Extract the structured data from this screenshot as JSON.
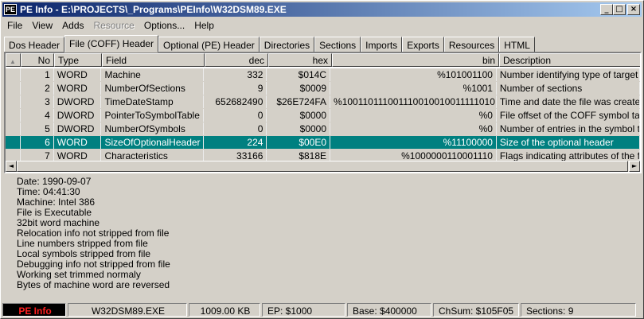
{
  "window": {
    "title": "PE Info - E:\\PROJECTS\\_Programs\\PEInfo\\W32DSM89.EXE",
    "icon_text": "PE",
    "minimize": "_",
    "maximize": "□",
    "close": "×"
  },
  "menu": [
    {
      "label": "File"
    },
    {
      "label": "View"
    },
    {
      "label": "Adds"
    },
    {
      "label": "Resource",
      "disabled": true
    },
    {
      "label": "Options..."
    },
    {
      "label": "Help"
    }
  ],
  "tabs": [
    {
      "label": "Dos Header"
    },
    {
      "label": "File (COFF) Header",
      "active": true
    },
    {
      "label": "Optional (PE) Header"
    },
    {
      "label": "Directories"
    },
    {
      "label": "Sections"
    },
    {
      "label": "Imports"
    },
    {
      "label": "Exports"
    },
    {
      "label": "Resources"
    },
    {
      "label": "HTML"
    }
  ],
  "table": {
    "sort_indicator": "▲",
    "columns": [
      "No",
      "Type",
      "Field",
      "dec",
      "hex",
      "bin",
      "Description"
    ],
    "rows": [
      {
        "no": "1",
        "type": "WORD",
        "field": "Machine",
        "dec": "332",
        "hex": "$014C",
        "bin": "%101001100",
        "desc": "Number identifying type of target mac"
      },
      {
        "no": "2",
        "type": "WORD",
        "field": "NumberOfSections",
        "dec": "9",
        "hex": "$0009",
        "bin": "%1001",
        "desc": "Number of sections"
      },
      {
        "no": "3",
        "type": "DWORD",
        "field": "TimeDateStamp",
        "dec": "652682490",
        "hex": "$26E724FA",
        "bin": "%100110111001110010010011111010",
        "desc": "Time and date the file was created"
      },
      {
        "no": "4",
        "type": "DWORD",
        "field": "PointerToSymbolTable",
        "dec": "0",
        "hex": "$0000",
        "bin": "%0",
        "desc": "File offset of the COFF symbol table o"
      },
      {
        "no": "5",
        "type": "DWORD",
        "field": "NumberOfSymbols",
        "dec": "0",
        "hex": "$0000",
        "bin": "%0",
        "desc": "Number of entries in the symbol table"
      },
      {
        "no": "6",
        "type": "WORD",
        "field": "SizeOfOptionalHeader",
        "dec": "224",
        "hex": "$00E0",
        "bin": "%11100000",
        "desc": "Size of the optional header",
        "selected": true
      },
      {
        "no": "7",
        "type": "WORD",
        "field": "Characteristics",
        "dec": "33166",
        "hex": "$818E",
        "bin": "%1000000110001110",
        "desc": "Flags indicating attributes of the file"
      }
    ]
  },
  "scroll": {
    "left": "◄",
    "right": "►"
  },
  "info_lines": [
    "Date: 1990-09-07",
    "Time: 04:41:30",
    "Machine: Intel 386",
    "File is Executable",
    "32bit word machine",
    "Relocation info not stripped from file",
    "Line numbers stripped from file",
    "Local symbols stripped from file",
    "Debugging info not stripped from file",
    "Working set trimmed normaly",
    "Bytes of machine word are reversed"
  ],
  "status": {
    "brand": "PE Info",
    "filename": "W32DSM89.EXE",
    "size": "1009.00 KB",
    "ep": "EP: $1000",
    "base": "Base: $400000",
    "checksum": "ChSum: $105F05",
    "sections": "Sections: 9"
  },
  "colors": {
    "selection": "#008080",
    "title_bar": "#0a246a",
    "brand_text": "#ff2020"
  }
}
